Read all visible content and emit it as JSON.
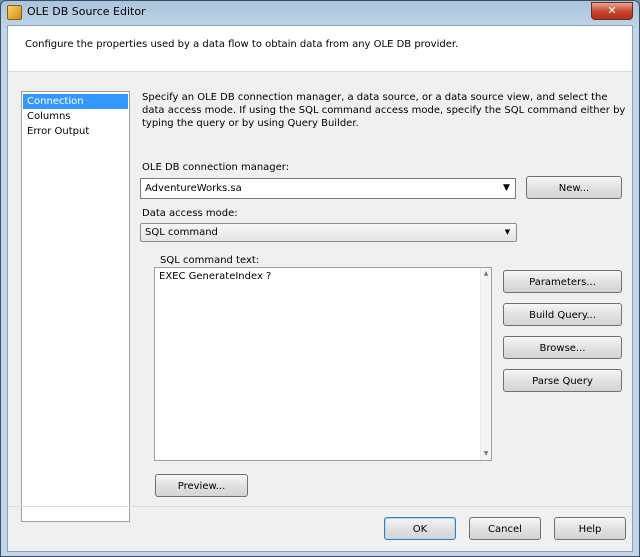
{
  "window": {
    "title": "OLE DB Source Editor",
    "close_glyph": "✕",
    "app_icon": "ssis-component-icon"
  },
  "header": {
    "text": "Configure the properties used by a data flow to obtain data from any OLE DB provider."
  },
  "nav": {
    "items": [
      {
        "label": "Connection Manager",
        "selected": true
      },
      {
        "label": "Columns",
        "selected": false
      },
      {
        "label": "Error Output",
        "selected": false
      }
    ]
  },
  "description": "Specify an OLE DB connection manager, a data source, or a data source view, and select the data access mode. If using the SQL command access mode, specify the SQL command either by typing the query or by using Query Builder.",
  "connection": {
    "label": "OLE DB connection manager:",
    "value": "AdventureWorks.sa",
    "new_button": "New..."
  },
  "access_mode": {
    "label": "Data access mode:",
    "value": "SQL command"
  },
  "sql": {
    "label": "SQL command text:",
    "text": "EXEC GenerateIndex ?"
  },
  "side_buttons": {
    "parameters": "Parameters...",
    "build_query": "Build Query...",
    "browse": "Browse...",
    "parse_query": "Parse Query"
  },
  "preview_button": "Preview...",
  "footer": {
    "ok": "OK",
    "cancel": "Cancel",
    "help": "Help"
  },
  "colors": {
    "selection": "#3399ff",
    "title_gradient": "#bcd1e4",
    "close_button": "#c8442a"
  }
}
